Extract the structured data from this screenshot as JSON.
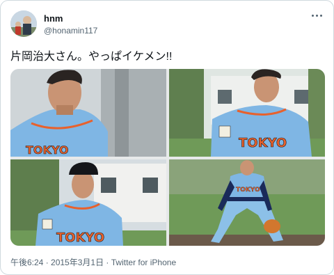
{
  "user": {
    "name": "hnm",
    "handle": "@honamin117"
  },
  "tweet": {
    "text": "片岡治大さん。やっぱイケメン!!",
    "photos": [
      {
        "jersey_text": "TOKYO",
        "accent": "#7fb6e4"
      },
      {
        "jersey_text": "TOKYO",
        "accent": "#7fb6e4"
      },
      {
        "jersey_text": "TOKYO",
        "accent": "#7fb6e4"
      },
      {
        "jersey_text": "TOKYO",
        "accent": "#7fb6e4"
      }
    ]
  },
  "meta": {
    "time": "午後6:24",
    "date": "2015年3月1日",
    "separator": " · ",
    "source": "Twitter for iPhone"
  },
  "colors": {
    "text_primary": "#0f1419",
    "text_secondary": "#536471",
    "jersey_orange": "#e8612c"
  }
}
